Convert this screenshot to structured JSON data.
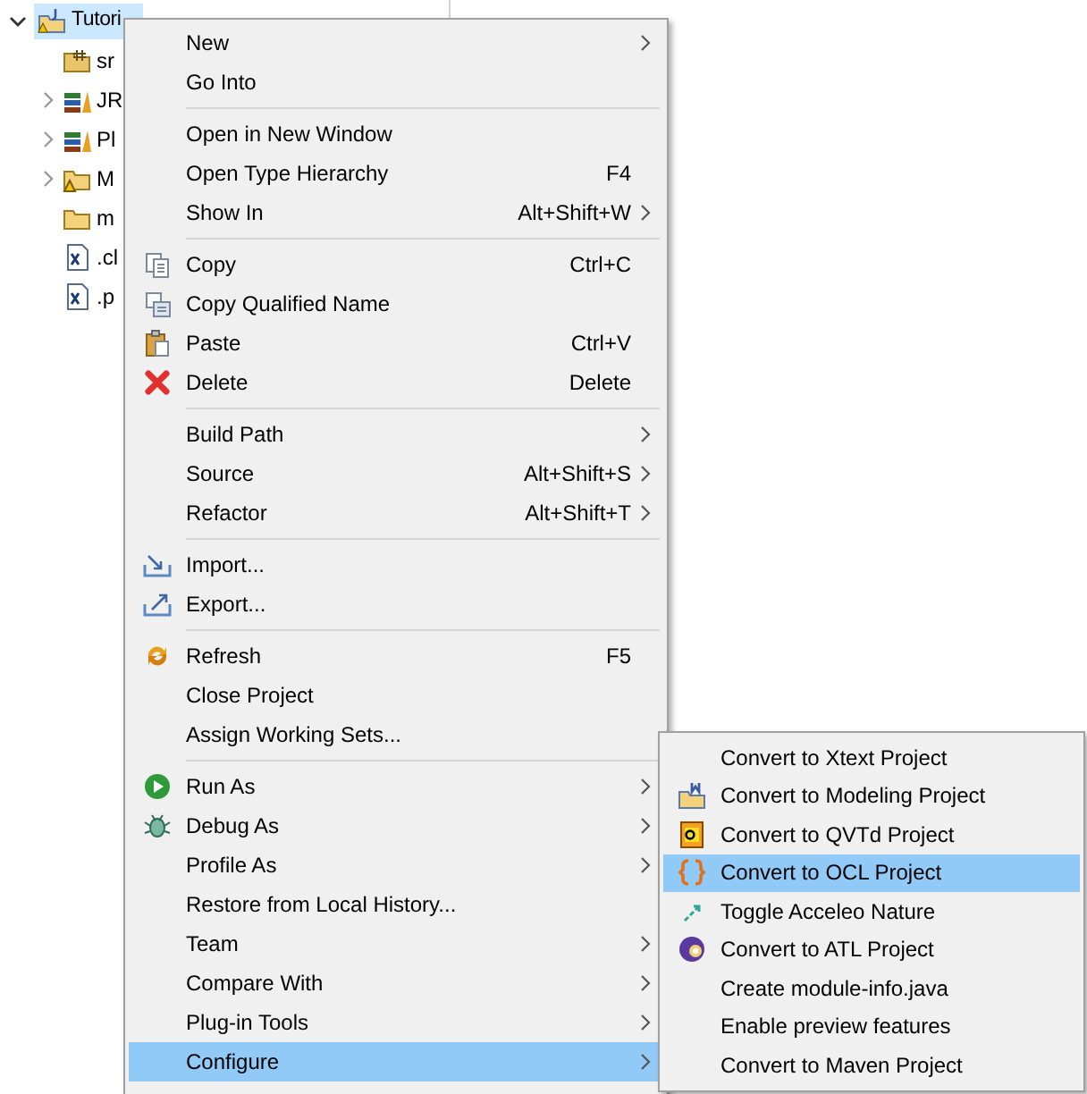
{
  "tree": {
    "label": "Tutori",
    "expanded": true,
    "selected": true,
    "children": [
      {
        "label": "sr",
        "kind": "package-folder",
        "expandable": false
      },
      {
        "label": "JR",
        "kind": "library",
        "expandable": true
      },
      {
        "label": "Pl",
        "kind": "library",
        "expandable": true
      },
      {
        "label": "M",
        "kind": "warning-folder",
        "expandable": true
      },
      {
        "label": "m",
        "kind": "folder",
        "expandable": false
      },
      {
        "label": ".cl",
        "kind": "xml-file",
        "expandable": false
      },
      {
        "label": ".p",
        "kind": "xml-file",
        "expandable": false
      }
    ]
  },
  "context_menu": {
    "groups": [
      [
        {
          "label": "New",
          "submenu": true,
          "selected": false
        },
        {
          "label": "Go Into",
          "submenu": false,
          "selected": false
        }
      ],
      [
        {
          "label": "Open in New Window",
          "submenu": false,
          "selected": false
        },
        {
          "label": "Open Type Hierarchy",
          "shortcut": "F4",
          "submenu": false,
          "selected": false
        },
        {
          "label": "Show In",
          "shortcut": "Alt+Shift+W",
          "submenu": true,
          "selected": false
        }
      ],
      [
        {
          "label": "Copy",
          "kind": "copy",
          "shortcut": "Ctrl+C",
          "submenu": false,
          "selected": false
        },
        {
          "label": "Copy Qualified Name",
          "kind": "copy-name",
          "submenu": false,
          "selected": false
        },
        {
          "label": "Paste",
          "kind": "paste",
          "shortcut": "Ctrl+V",
          "submenu": false,
          "selected": false
        },
        {
          "label": "Delete",
          "kind": "delete",
          "shortcut": "Delete",
          "submenu": false,
          "selected": false
        }
      ],
      [
        {
          "label": "Build Path",
          "submenu": true,
          "selected": false
        },
        {
          "label": "Source",
          "shortcut": "Alt+Shift+S",
          "submenu": true,
          "selected": false
        },
        {
          "label": "Refactor",
          "shortcut": "Alt+Shift+T",
          "submenu": true,
          "selected": false
        }
      ],
      [
        {
          "label": "Import...",
          "kind": "import",
          "submenu": false,
          "selected": false
        },
        {
          "label": "Export...",
          "kind": "export",
          "submenu": false,
          "selected": false
        }
      ],
      [
        {
          "label": "Refresh",
          "kind": "refresh",
          "shortcut": "F5",
          "submenu": false,
          "selected": false
        },
        {
          "label": "Close Project",
          "submenu": false,
          "selected": false
        },
        {
          "label": "Assign Working Sets...",
          "submenu": false,
          "selected": false
        }
      ],
      [
        {
          "label": "Run As",
          "kind": "run",
          "submenu": true,
          "selected": false
        },
        {
          "label": "Debug As",
          "kind": "debug",
          "submenu": true,
          "selected": false
        },
        {
          "label": "Profile As",
          "submenu": true,
          "selected": false
        },
        {
          "label": "Restore from Local History...",
          "submenu": false,
          "selected": false
        },
        {
          "label": "Team",
          "submenu": true,
          "selected": false
        },
        {
          "label": "Compare With",
          "submenu": true,
          "selected": false
        },
        {
          "label": "Plug-in Tools",
          "submenu": true,
          "selected": false
        },
        {
          "label": "Configure",
          "submenu": true,
          "selected": true
        }
      ]
    ]
  },
  "configure_submenu": {
    "items": [
      {
        "label": "Convert to Xtext Project",
        "selected": false
      },
      {
        "label": "Convert to Modeling Project",
        "kind": "modeling",
        "selected": false
      },
      {
        "label": "Convert to QVTd Project",
        "kind": "qvtd",
        "selected": false
      },
      {
        "label": "Convert to OCL Project",
        "kind": "ocl",
        "selected": true
      },
      {
        "label": "Toggle Acceleo Nature",
        "kind": "acceleo",
        "selected": false
      },
      {
        "label": "Convert to ATL Project",
        "kind": "atl",
        "selected": false
      },
      {
        "label": "Create module-info.java",
        "selected": false
      },
      {
        "label": "Enable preview features",
        "selected": false
      },
      {
        "label": "Convert to Maven Project",
        "selected": false
      }
    ]
  }
}
